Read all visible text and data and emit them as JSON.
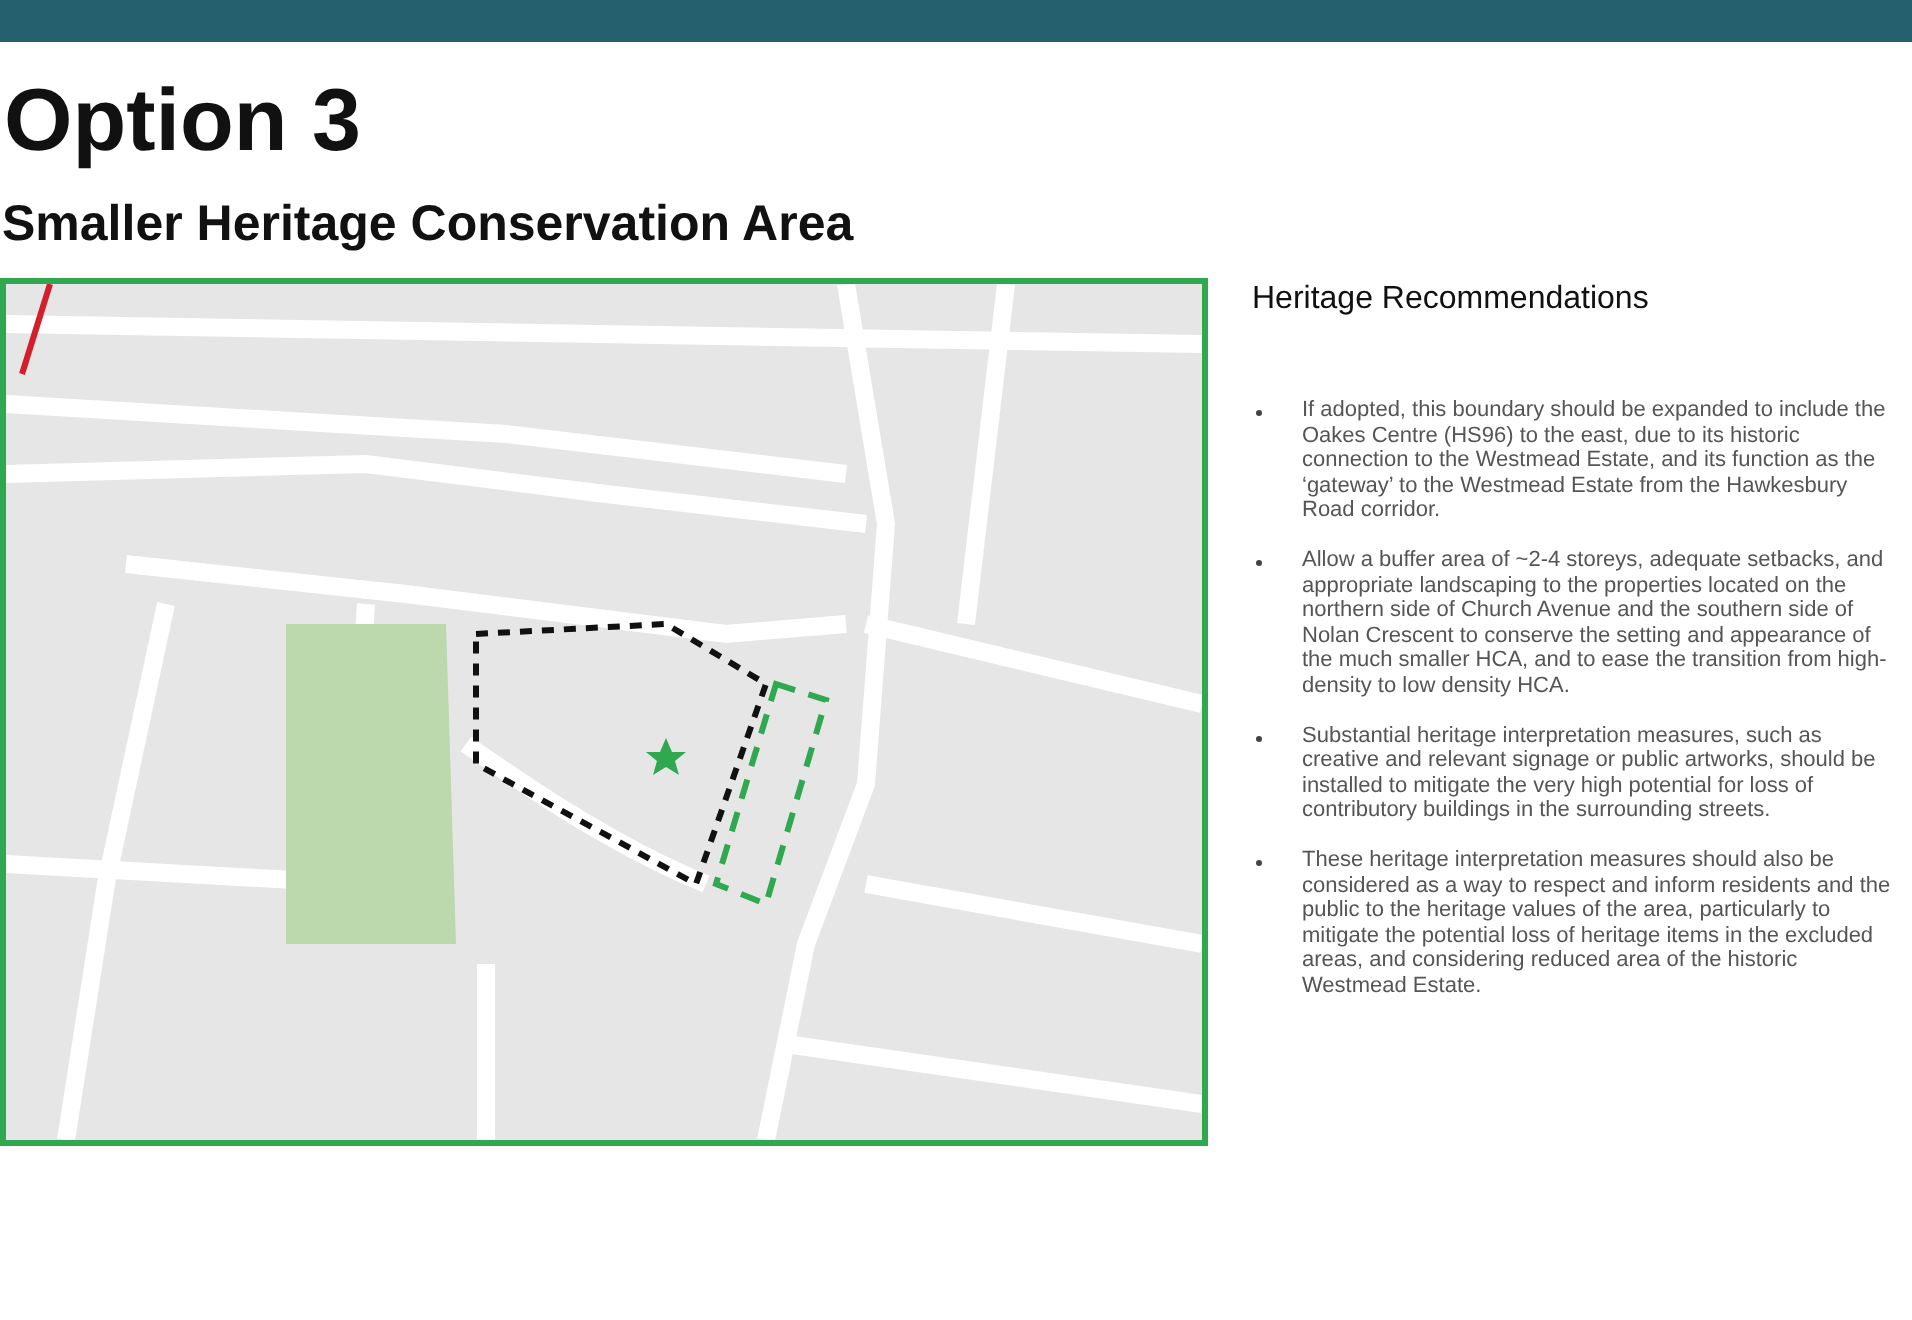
{
  "title": "Option 3",
  "subtitle": "Smaller Heritage Conservation Area",
  "recommendations": {
    "heading": "Heritage Recommendations",
    "items": [
      "If adopted, this boundary should be expanded to include the Oakes Centre (HS96) to the east, due to its historic connection to the Westmead Estate, and its function as the ‘gateway’ to the Westmead Estate from the Hawkesbury Road corridor.",
      "Allow a buffer area of ~2-4 storeys, adequate setbacks, and appropriate landscaping to the properties located on the northern side of Church Avenue and the southern side of Nolan Crescent to conserve the setting and appearance of the much smaller HCA, and to ease the transition from high-density to low density HCA.",
      "Substantial heritage interpretation measures, such as creative and relevant signage or public artworks, should be installed to mitigate the very high potential for loss of contributory buildings in the surrounding streets.",
      "These heritage interpretation measures should also be considered as a way to respect and inform residents and the public to the heritage values of the area, particularly to mitigate the potential loss of heritage items in the excluded areas, and considering reduced area of the historic Westmead Estate."
    ]
  }
}
